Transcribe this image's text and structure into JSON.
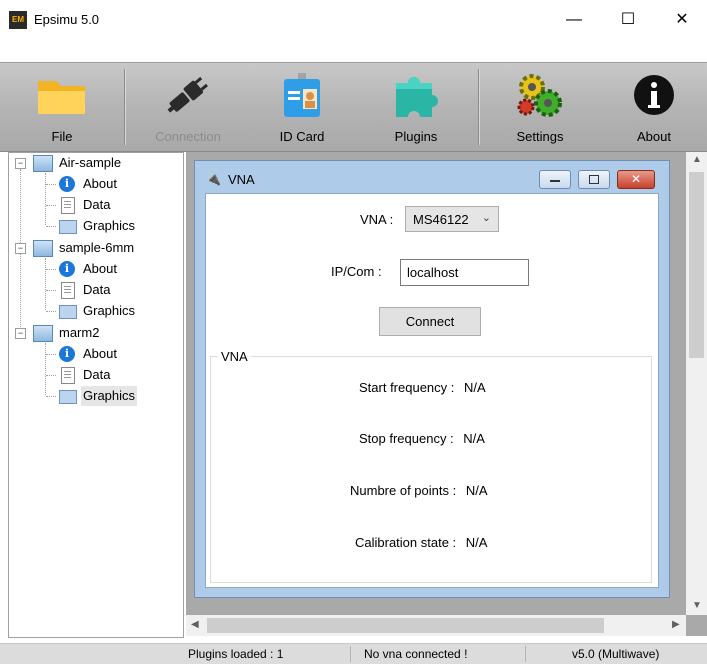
{
  "window": {
    "app_icon_text": "EM",
    "title": "Epsimu 5.0",
    "minimize": "—",
    "maximize": "☐",
    "close": "✕"
  },
  "toolbar": {
    "file": "File",
    "connection": "Connection",
    "id_card": "ID Card",
    "plugins": "Plugins",
    "settings": "Settings",
    "about": "About"
  },
  "tree": {
    "projects": [
      {
        "name": "Air-sample",
        "children": [
          "About",
          "Data",
          "Graphics"
        ]
      },
      {
        "name": "sample-6mm",
        "children": [
          "About",
          "Data",
          "Graphics"
        ]
      },
      {
        "name": "marm2",
        "children": [
          "About",
          "Data",
          "Graphics"
        ]
      }
    ],
    "selected": "marm2/Graphics"
  },
  "vna_window": {
    "title": "VNA",
    "vna_label": "VNA :",
    "vna_selected": "MS46122",
    "ip_label": "IP/Com :",
    "ip_value": "localhost",
    "connect_label": "Connect",
    "group_title": "VNA",
    "fields": [
      {
        "label": "Start frequency :",
        "value": "N/A"
      },
      {
        "label": "Stop frequency :",
        "value": "N/A"
      },
      {
        "label": "Numbre of points :",
        "value": "N/A"
      },
      {
        "label": "Calibration state :",
        "value": "N/A"
      }
    ]
  },
  "status": {
    "plugins": "Plugins loaded : 1",
    "vna": "No vna connected !",
    "version": "v5.0 (Multiwave)"
  },
  "colors": {
    "toolbar_bg": "#b4b4b4",
    "mdi_bg": "#a9a9a9",
    "child_frame": "#aecbe9",
    "selection": "#e5e5e5"
  }
}
